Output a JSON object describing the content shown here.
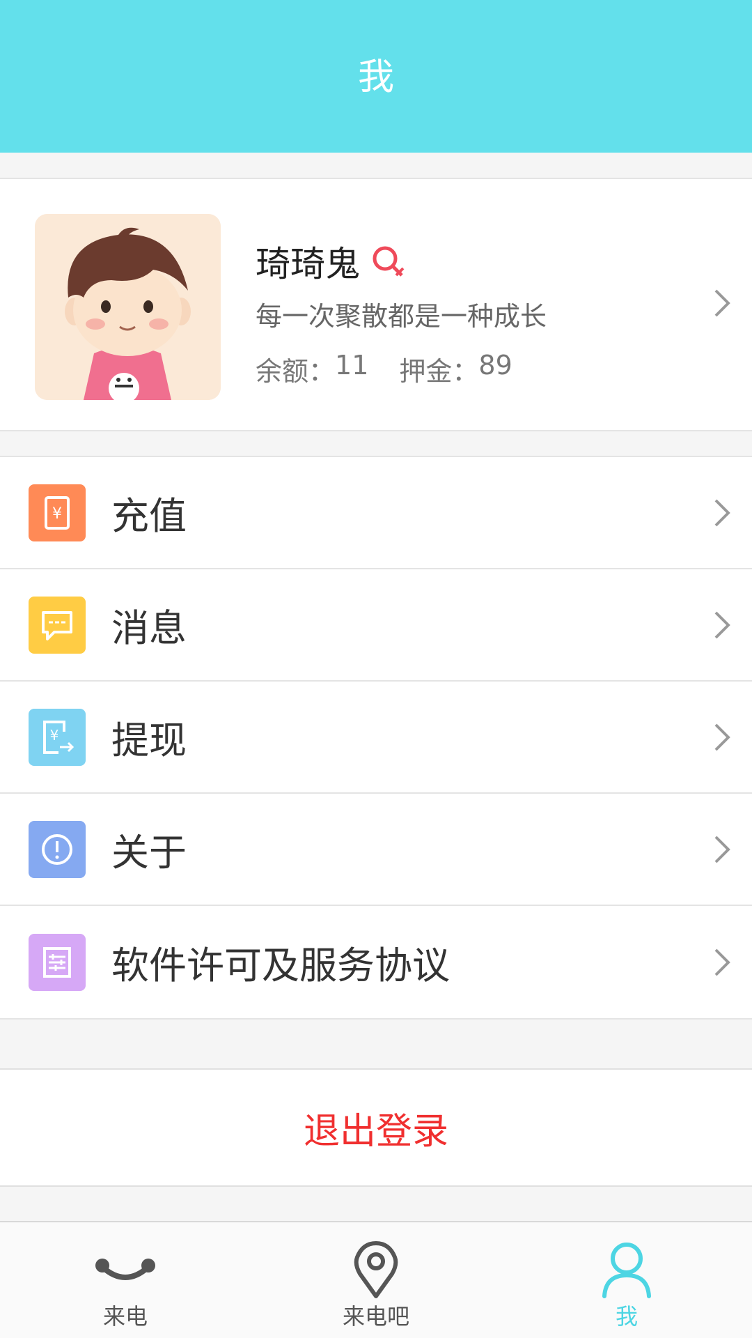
{
  "header": {
    "title": "我"
  },
  "profile": {
    "name": "琦琦鬼",
    "gender_icon": "female-icon",
    "signature": "每一次聚散都是一种成长",
    "balance_label": "余额：",
    "balance_value": "11",
    "deposit_label": "押金：",
    "deposit_value": "89"
  },
  "menu": [
    {
      "label": "充值",
      "icon": "recharge-icon",
      "color": "#ff8a56"
    },
    {
      "label": "消息",
      "icon": "message-icon",
      "color": "#ffcc44"
    },
    {
      "label": "提现",
      "icon": "withdraw-icon",
      "color": "#7fd3f2"
    },
    {
      "label": "关于",
      "icon": "about-icon",
      "color": "#85a9f1"
    },
    {
      "label": "软件许可及服务协议",
      "icon": "license-icon",
      "color": "#d6a8f6"
    }
  ],
  "logout": {
    "label": "退出登录",
    "color": "#f02f2f"
  },
  "tabs": [
    {
      "label": "来电",
      "icon": "phone-handset-icon",
      "active": false
    },
    {
      "label": "来电吧",
      "icon": "location-pin-icon",
      "active": false
    },
    {
      "label": "我",
      "icon": "user-icon",
      "active": true
    }
  ],
  "colors": {
    "accent": "#63e0eb",
    "active_tab": "#4dd5e3"
  }
}
